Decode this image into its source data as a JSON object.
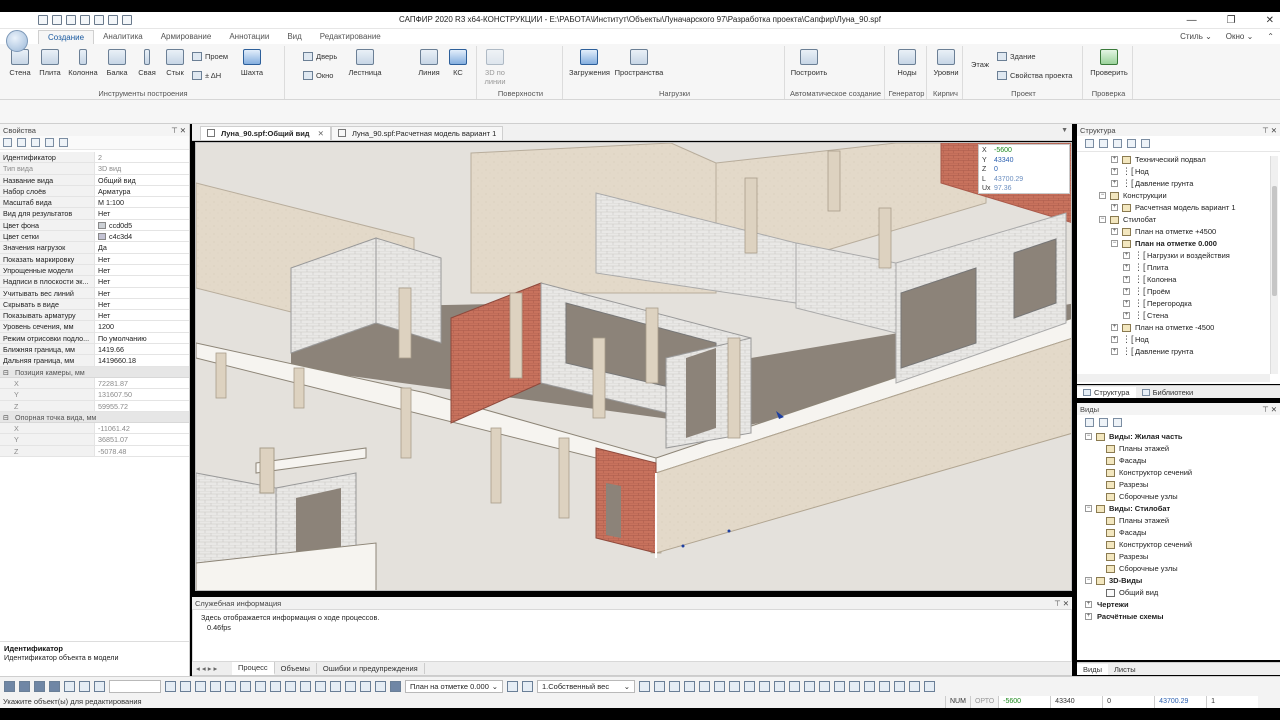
{
  "window": {
    "title": "САПФИР 2020 R3 x64-КОНСТРУКЦИИ - E:\\РАБОТА\\Институт\\Объекты\\Луначарского 97\\Разработка проекта\\Сапфир\\Луна_90.spf",
    "minimize": "—",
    "maximize": "❐",
    "close": "✕"
  },
  "ribbon": {
    "tabs": [
      "Создание",
      "Аналитика",
      "Армирование",
      "Аннотации",
      "Вид",
      "Редактирование"
    ],
    "right": [
      "Стиль ⌄",
      "Окно ⌄"
    ],
    "buttons": {
      "wall": "Стена",
      "slab": "Плита",
      "column": "Колонна",
      "beam": "Балка",
      "pile": "Свая",
      "joint": "Стык",
      "opening": "Проем",
      "dh": "± ΔН",
      "shaft": "Шахта",
      "door": "Дверь",
      "window": "Окно",
      "stair": "Лестница",
      "line": "Линия",
      "ks": "КС",
      "threed": "3D по линии",
      "loads": "Загружения",
      "spaces": "Пространства",
      "build": "Построить",
      "nodes": "Ноды",
      "levels": "Уровни",
      "floor": "Этаж",
      "building": "Здание",
      "props": "Свойства проекта",
      "check": "Проверить"
    },
    "groups": [
      "Инструменты построения",
      "Поверхности",
      "Нагрузки",
      "Автоматическое создание",
      "Генератор",
      "Кирпич",
      "Проект",
      "Проверка"
    ]
  },
  "properties": {
    "header": "Свойства",
    "pin": "⊤ ✕",
    "rows": [
      {
        "k": "Идентификатор",
        "v": "2",
        "dim": false
      },
      {
        "k": "Тип вида",
        "v": "3D вид",
        "dim": true
      },
      {
        "k": "Название вида",
        "v": "Общий вид",
        "dim": false
      },
      {
        "k": "Набор слоёв",
        "v": "Арматура",
        "dim": false
      },
      {
        "k": "Масштаб вида",
        "v": "М 1:100",
        "dim": false
      },
      {
        "k": "Вид для результатов",
        "v": "Нет",
        "dim": false
      },
      {
        "k": "Цвет фона",
        "v": "ccd0d5",
        "dim": false,
        "swatch": "#ccd0d5"
      },
      {
        "k": "Цвет сетки",
        "v": "c4c3d4",
        "dim": false,
        "swatch": "#c4c3d4"
      },
      {
        "k": "Значения нагрузок",
        "v": "Да",
        "dim": false
      },
      {
        "k": "Показать маркировку",
        "v": "Нет",
        "dim": false
      },
      {
        "k": "Упрощенные модели",
        "v": "Нет",
        "dim": false
      },
      {
        "k": "Надписи в плоскости эк...",
        "v": "Нет",
        "dim": false
      },
      {
        "k": "Учитывать вес линий",
        "v": "Нет",
        "dim": false
      },
      {
        "k": "Скрывать в виде",
        "v": "Нет",
        "dim": false
      },
      {
        "k": "Показывать арматуру",
        "v": "Нет",
        "dim": false
      },
      {
        "k": "Уровень сечения, мм",
        "v": "1200",
        "dim": false
      },
      {
        "k": "Режим отрисовки подло...",
        "v": "По умолчанию",
        "dim": false
      },
      {
        "k": "Ближняя граница, мм",
        "v": "1419.66",
        "dim": false
      },
      {
        "k": "Дальняя граница, мм",
        "v": "1419660.18",
        "dim": false
      }
    ],
    "camera_header": "Позиция камеры, мм",
    "camera": [
      {
        "k": "X",
        "v": "72281.87"
      },
      {
        "k": "Y",
        "v": "131607.50"
      },
      {
        "k": "Z",
        "v": "59955.72"
      }
    ],
    "ref_header": "Опорная точка вида, мм",
    "ref": [
      {
        "k": "X",
        "v": "-11061.42"
      },
      {
        "k": "Y",
        "v": "36851.07"
      },
      {
        "k": "Z",
        "v": "-5078.48"
      }
    ],
    "desc_title": "Идентификатор",
    "desc_text": "Идентификатор объекта в модели"
  },
  "doc_tabs": [
    {
      "label": "Луна_90.spf:Общий вид",
      "close": "✕",
      "active": true
    },
    {
      "label": "Луна_90.spf:Расчетная модель вариант 1",
      "close": "",
      "active": false
    }
  ],
  "coords": {
    "x_label": "X",
    "x": "-5600",
    "y_label": "Y",
    "y": "43340",
    "z_label": "Z",
    "z": "0",
    "l_label": "L",
    "l": "43700.29",
    "u_label": "Ux",
    "u": "97.36"
  },
  "service": {
    "header": "Служебная информация",
    "line1": "Здесь отображается информация о ходе процессов.",
    "line2": "0.46fps",
    "tabs": [
      "Процесс",
      "Объемы",
      "Ошибки и предупреждения"
    ]
  },
  "structure": {
    "header": "Структура",
    "items": [
      {
        "label": "Технический подвал",
        "level": 2,
        "icon": "folder",
        "exp": "+"
      },
      {
        "label": "Нод",
        "level": 2,
        "icon": "node",
        "exp": "+"
      },
      {
        "label": "Давление грунта",
        "level": 2,
        "icon": "node",
        "exp": "+"
      },
      {
        "label": "Конструкции",
        "level": 1,
        "icon": "folder",
        "exp": "-"
      },
      {
        "label": "Расчетная модель вариант 1",
        "level": 2,
        "icon": "folder",
        "exp": "+"
      },
      {
        "label": "Стилобат",
        "level": 1,
        "icon": "folder",
        "exp": "-"
      },
      {
        "label": "План на отметке +4500",
        "level": 2,
        "icon": "folder",
        "exp": "+"
      },
      {
        "label": "План на отметке 0.000",
        "level": 2,
        "icon": "folder",
        "exp": "-",
        "bold": true
      },
      {
        "label": "Нагрузки и воздействия",
        "level": 3,
        "icon": "node",
        "exp": "+"
      },
      {
        "label": "Плита",
        "level": 3,
        "icon": "node",
        "exp": "+"
      },
      {
        "label": "Колонна",
        "level": 3,
        "icon": "node",
        "exp": "+"
      },
      {
        "label": "Проём",
        "level": 3,
        "icon": "node",
        "exp": "+"
      },
      {
        "label": "Перегородка",
        "level": 3,
        "icon": "node",
        "exp": "+"
      },
      {
        "label": "Стена",
        "level": 3,
        "icon": "node",
        "exp": "+"
      },
      {
        "label": "План на отметке -4500",
        "level": 2,
        "icon": "folder",
        "exp": "+"
      },
      {
        "label": "Нод",
        "level": 2,
        "icon": "node",
        "exp": "+"
      },
      {
        "label": "Давление грунта",
        "level": 2,
        "icon": "node",
        "exp": "+"
      }
    ],
    "tabs": [
      "Структура",
      "Библиотеки"
    ]
  },
  "views": {
    "header": "Виды",
    "items": [
      {
        "label": "Виды: Жилая часть",
        "level": 0,
        "exp": "-",
        "bold": true,
        "icon": "folder"
      },
      {
        "label": "Планы этажей",
        "level": 1,
        "exp": "",
        "icon": "folder"
      },
      {
        "label": "Фасады",
        "level": 1,
        "exp": "",
        "icon": "folder"
      },
      {
        "label": "Конструктор сечений",
        "level": 1,
        "exp": "",
        "icon": "folder"
      },
      {
        "label": "Разрезы",
        "level": 1,
        "exp": "",
        "icon": "folder"
      },
      {
        "label": "Сборочные узлы",
        "level": 1,
        "exp": "",
        "icon": "folder"
      },
      {
        "label": "Виды: Стилобат",
        "level": 0,
        "exp": "-",
        "bold": true,
        "icon": "folder"
      },
      {
        "label": "Планы этажей",
        "level": 1,
        "exp": "",
        "icon": "folder"
      },
      {
        "label": "Фасады",
        "level": 1,
        "exp": "",
        "icon": "folder"
      },
      {
        "label": "Конструктор сечений",
        "level": 1,
        "exp": "",
        "icon": "folder"
      },
      {
        "label": "Разрезы",
        "level": 1,
        "exp": "",
        "icon": "folder"
      },
      {
        "label": "Сборочные узлы",
        "level": 1,
        "exp": "",
        "icon": "folder"
      },
      {
        "label": "3D-Виды",
        "level": 0,
        "exp": "-",
        "bold": true,
        "icon": "folder"
      },
      {
        "label": "Общий вид",
        "level": 1,
        "exp": "",
        "icon": "view"
      },
      {
        "label": "Чертежи",
        "level": 0,
        "exp": "+",
        "bold": true,
        "icon": "none"
      },
      {
        "label": "Расчётные схемы",
        "level": 0,
        "exp": "+",
        "bold": true,
        "icon": "none"
      }
    ],
    "tabs": [
      "Виды",
      "Листы"
    ]
  },
  "bottombar": {
    "level_select": "План на отметке 0.000",
    "load_select": "1.Собственный вес"
  },
  "status": {
    "text": "Укажите объект(ы) для редактирования",
    "num": "NUM",
    "orto": "ОРТО",
    "x": "-5600",
    "y": "43340",
    "z": "0",
    "l": "43700.29",
    "u": "1"
  },
  "colors": {
    "accent": "#1a5aa0",
    "brick": "#c56a55",
    "slab": "#f4f2ee",
    "floor": "#8c8379",
    "wall": "#e2d8c8",
    "masonry": "#e8e6e2"
  }
}
